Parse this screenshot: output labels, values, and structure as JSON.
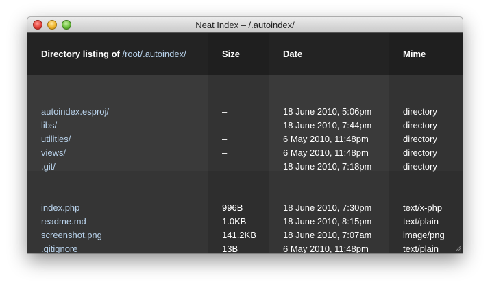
{
  "window": {
    "title": "Neat Index – /.autoindex/"
  },
  "header": {
    "listing_prefix": "Directory listing of ",
    "listing_path": "/root/.autoindex/",
    "size_label": "Size",
    "date_label": "Date",
    "mime_label": "Mime"
  },
  "directories": [
    {
      "name": "autoindex.esproj/",
      "size": "–",
      "date": "18 June 2010, 5:06pm",
      "mime": "directory"
    },
    {
      "name": "libs/",
      "size": "–",
      "date": "18 June 2010, 7:44pm",
      "mime": "directory"
    },
    {
      "name": "utilities/",
      "size": "–",
      "date": "6 May 2010, 11:48pm",
      "mime": "directory"
    },
    {
      "name": "views/",
      "size": "–",
      "date": "6 May 2010, 11:48pm",
      "mime": "directory"
    },
    {
      "name": ".git/",
      "size": "–",
      "date": "18 June 2010, 7:18pm",
      "mime": "directory"
    }
  ],
  "files": [
    {
      "name": "index.php",
      "size": "996B",
      "date": "18 June 2010, 7:30pm",
      "mime": "text/x-php"
    },
    {
      "name": "readme.md",
      "size": "1.0KB",
      "date": "18 June 2010, 8:15pm",
      "mime": "text/plain"
    },
    {
      "name": "screenshot.png",
      "size": "141.2KB",
      "date": "18 June 2010, 7:07am",
      "mime": "image/png"
    },
    {
      "name": ".gitignore",
      "size": "13B",
      "date": "6 May 2010, 11:48pm",
      "mime": "text/plain"
    }
  ],
  "colors": {
    "header_bg_name": "#232323",
    "header_bg_size": "#1f1f1f",
    "header_bg_date": "#232323",
    "header_bg_mime": "#1f1f1f",
    "dir_bg_name": "#3a3a3a",
    "dir_bg_size": "#333333",
    "dir_bg_date": "#3a3a3a",
    "dir_bg_mime": "#333333",
    "file_bg_name": "#353535",
    "file_bg_size": "#2e2e2e",
    "file_bg_date": "#353535",
    "file_bg_mime": "#2e2e2e",
    "link": "#b9d3ec"
  }
}
